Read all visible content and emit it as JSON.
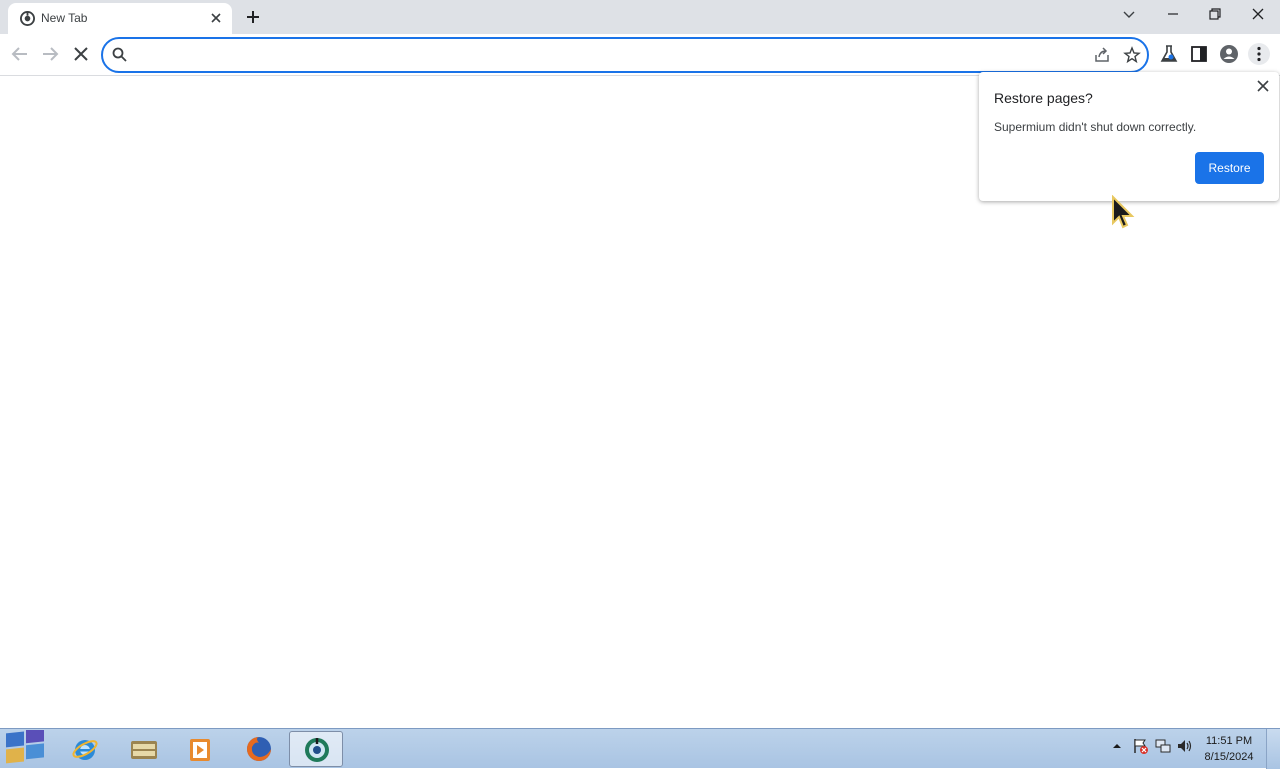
{
  "tab": {
    "title": "New Tab",
    "favicon": "supermium-icon"
  },
  "omnibox": {
    "value": "",
    "placeholder": ""
  },
  "bubble": {
    "title": "Restore pages?",
    "message": "Supermium didn't shut down correctly.",
    "restore_label": "Restore"
  },
  "taskbar": {
    "apps": [
      "internet-explorer-icon",
      "library-icon",
      "media-player-icon",
      "firefox-icon",
      "supermium-icon"
    ],
    "time": "11:51 PM",
    "date": "8/15/2024"
  },
  "colors": {
    "accent": "#1a73e8",
    "tabstrip": "#dee1e6",
    "taskbar": "#b3cbe6"
  }
}
